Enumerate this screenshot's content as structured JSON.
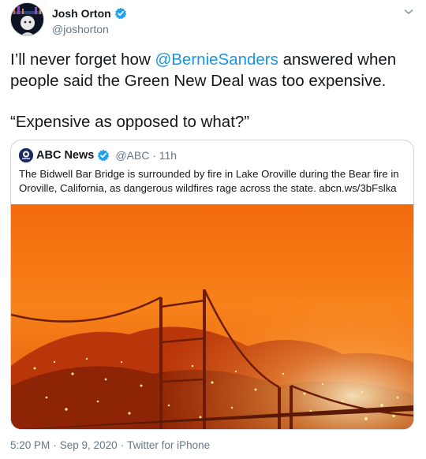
{
  "author": {
    "name": "Josh Orton",
    "handle": "@joshorton",
    "verified_color": "#1da1f2"
  },
  "tweet": {
    "text_before": "I’ll never forget how ",
    "mention": "@BernieSanders",
    "text_after": " answered when people said the Green New Deal was too expensive.",
    "quote_line": "“Expensive as opposed to what?”"
  },
  "quoted": {
    "name": "ABC News",
    "handle": "@ABC · 11h",
    "text": "The Bidwell Bar Bridge is surrounded by fire in Lake Oroville during the Bear fire in Oroville, California, as dangerous wildfires rage across the state. abcn.ws/3bFslka",
    "image": "orange-wildfire-bridge-photo"
  },
  "footer": {
    "time": "5:20 PM",
    "sep1": "·",
    "date": "Sep 9, 2020",
    "sep2": "·",
    "source": "Twitter for iPhone"
  },
  "icons": {
    "caret": "chevron-down-icon",
    "verified": "verified-badge-icon"
  },
  "colors": {
    "link": "#1b95e0",
    "secondary": "#657786",
    "border": "#ccd6dd"
  }
}
